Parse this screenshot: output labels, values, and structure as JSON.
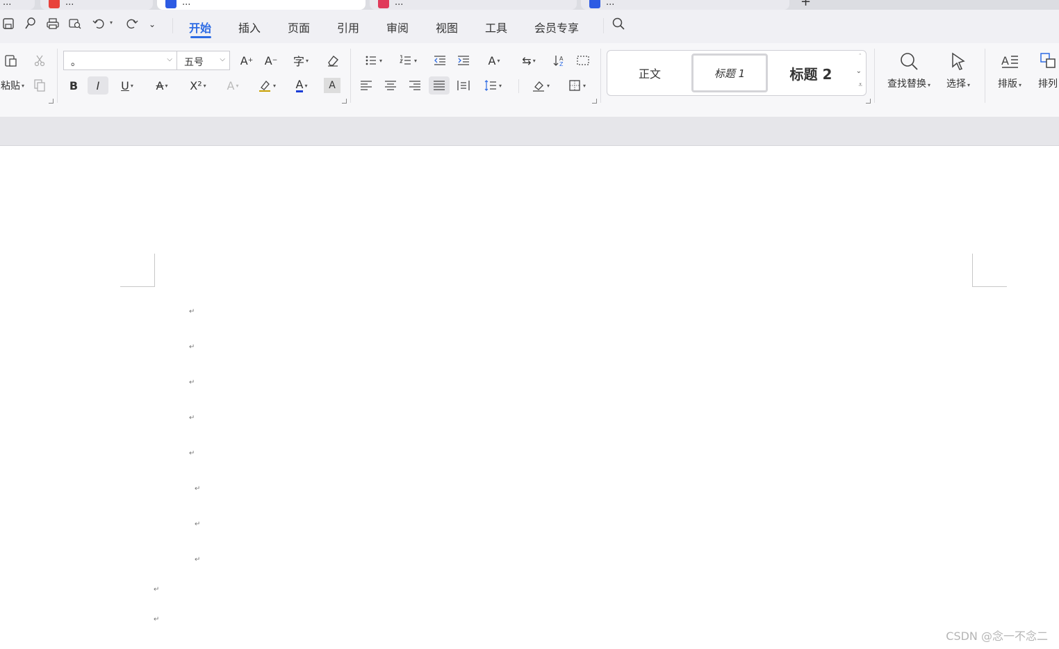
{
  "tabs": [
    {
      "label": "..."
    },
    {
      "label": "...",
      "color": "#e8413a"
    },
    {
      "label": "...",
      "color": "#2d5be3",
      "active": true
    },
    {
      "label": "...",
      "color": "#e03a5a"
    },
    {
      "label": "...",
      "color": "#2d5be3"
    }
  ],
  "menu": {
    "items": [
      "开始",
      "插入",
      "页面",
      "引用",
      "审阅",
      "视图",
      "工具",
      "会员专享"
    ],
    "active_index": 0,
    "accent": "#2d6be4"
  },
  "ribbon": {
    "paste_label": "粘贴",
    "font_name": "。",
    "font_size": "五号",
    "styles": [
      "正文",
      "标题 1",
      "标题 2"
    ],
    "find_replace_label": "查找替换",
    "select_label": "选择",
    "layout_label": "排版",
    "arrange_label": "排列",
    "bold_glyph": "B",
    "italic_glyph": "I",
    "underline_glyph": "U",
    "strike_glyph": "A",
    "superscript_glyph": "X²",
    "font_color": "#1a3cd6"
  },
  "document": {
    "paragraph_mark": "↵"
  },
  "watermark": "CSDN @念一不念二"
}
